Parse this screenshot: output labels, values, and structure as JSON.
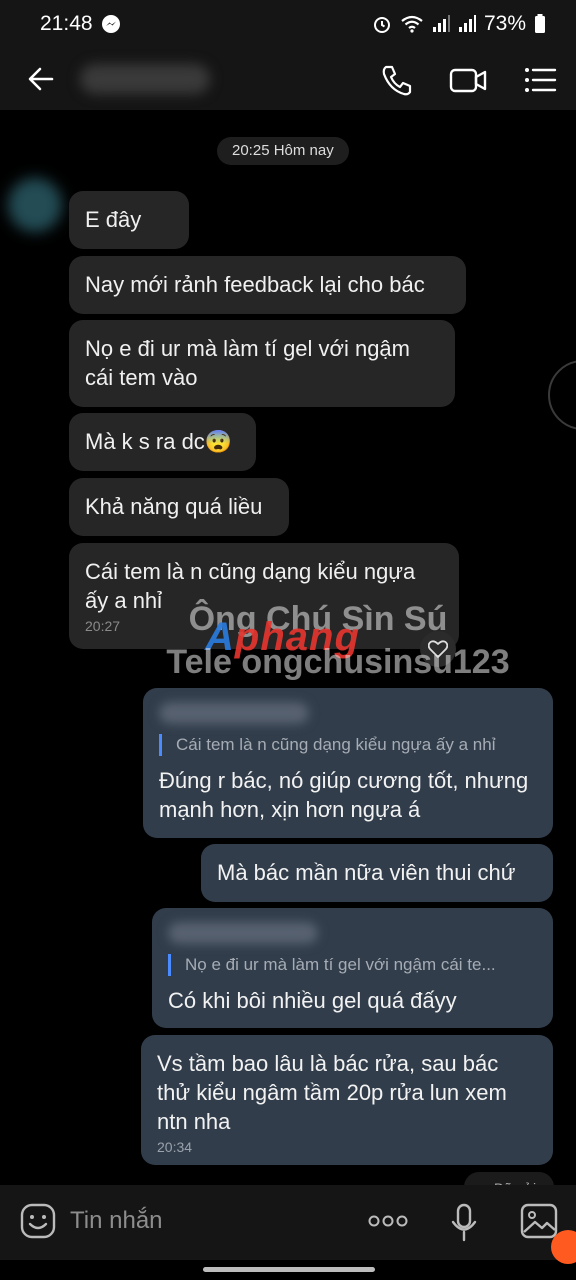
{
  "status_bar": {
    "time": "21:48",
    "battery": "73%"
  },
  "header": {
    "icons": [
      "back-arrow-icon",
      "phone-icon",
      "video-call-icon",
      "menu-icon"
    ]
  },
  "chat": {
    "date_chip": "20:25 Hôm nay",
    "incoming": [
      {
        "text": "E đây"
      },
      {
        "text": "Nay mới rảnh feedback lại cho bác"
      },
      {
        "text": "Nọ e đi ur mà làm tí gel với ngậm cái tem vào"
      },
      {
        "text": "Mà k s ra dc😨"
      },
      {
        "text": "Khả năng quá liều"
      },
      {
        "text": "Cái tem là n cũng dạng kiểu ngựa ấy a nhỉ",
        "time": "20:27"
      }
    ],
    "outgoing": [
      {
        "quote": "Cái tem là n cũng dạng kiểu ngựa ấy a nhỉ",
        "text": "Đúng r bác, nó giúp cương tốt, nhưng mạnh hơn, xịn hơn ngựa á"
      },
      {
        "text": "Mà bác mần nữa viên thui chứ"
      },
      {
        "quote": "Nọ e đi ur mà làm tí gel với ngậm cái te...",
        "text": "Có khi bôi nhiều gel quá đấyy"
      },
      {
        "text": "Vs tầm bao lâu là bác rửa, sau bác thử kiểu ngâm tầm 20p rửa lun xem ntn nha",
        "time": "20:34"
      }
    ],
    "seen_label": "Đã gửi"
  },
  "watermark": {
    "line1": "Ông Chú Sìn Sú",
    "line2": "Tele ongchusinsu123",
    "logo_a": "A",
    "logo_rest": "phang"
  },
  "input_bar": {
    "placeholder": "Tin nhắn"
  },
  "colors": {
    "incoming_bubble": "#262626",
    "outgoing_bubble": "#313d4b",
    "quote_accent": "#4a8cff"
  }
}
